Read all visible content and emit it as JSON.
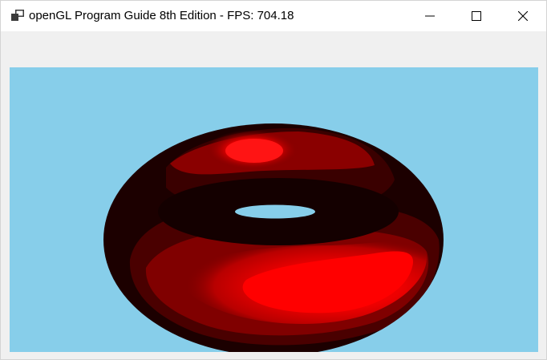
{
  "window": {
    "title": "openGL Program Guide 8th Edition - FPS: 704.18",
    "controls": {
      "minimize": "minimize",
      "maximize": "maximize",
      "close": "close"
    }
  },
  "icons": {
    "app": "app-window-icon",
    "minimize": "minimize-icon",
    "maximize": "maximize-icon",
    "close": "close-icon"
  },
  "viewport": {
    "background_color": "#87ceea",
    "object": "shaded red torus",
    "object_color": "#ff0000"
  }
}
